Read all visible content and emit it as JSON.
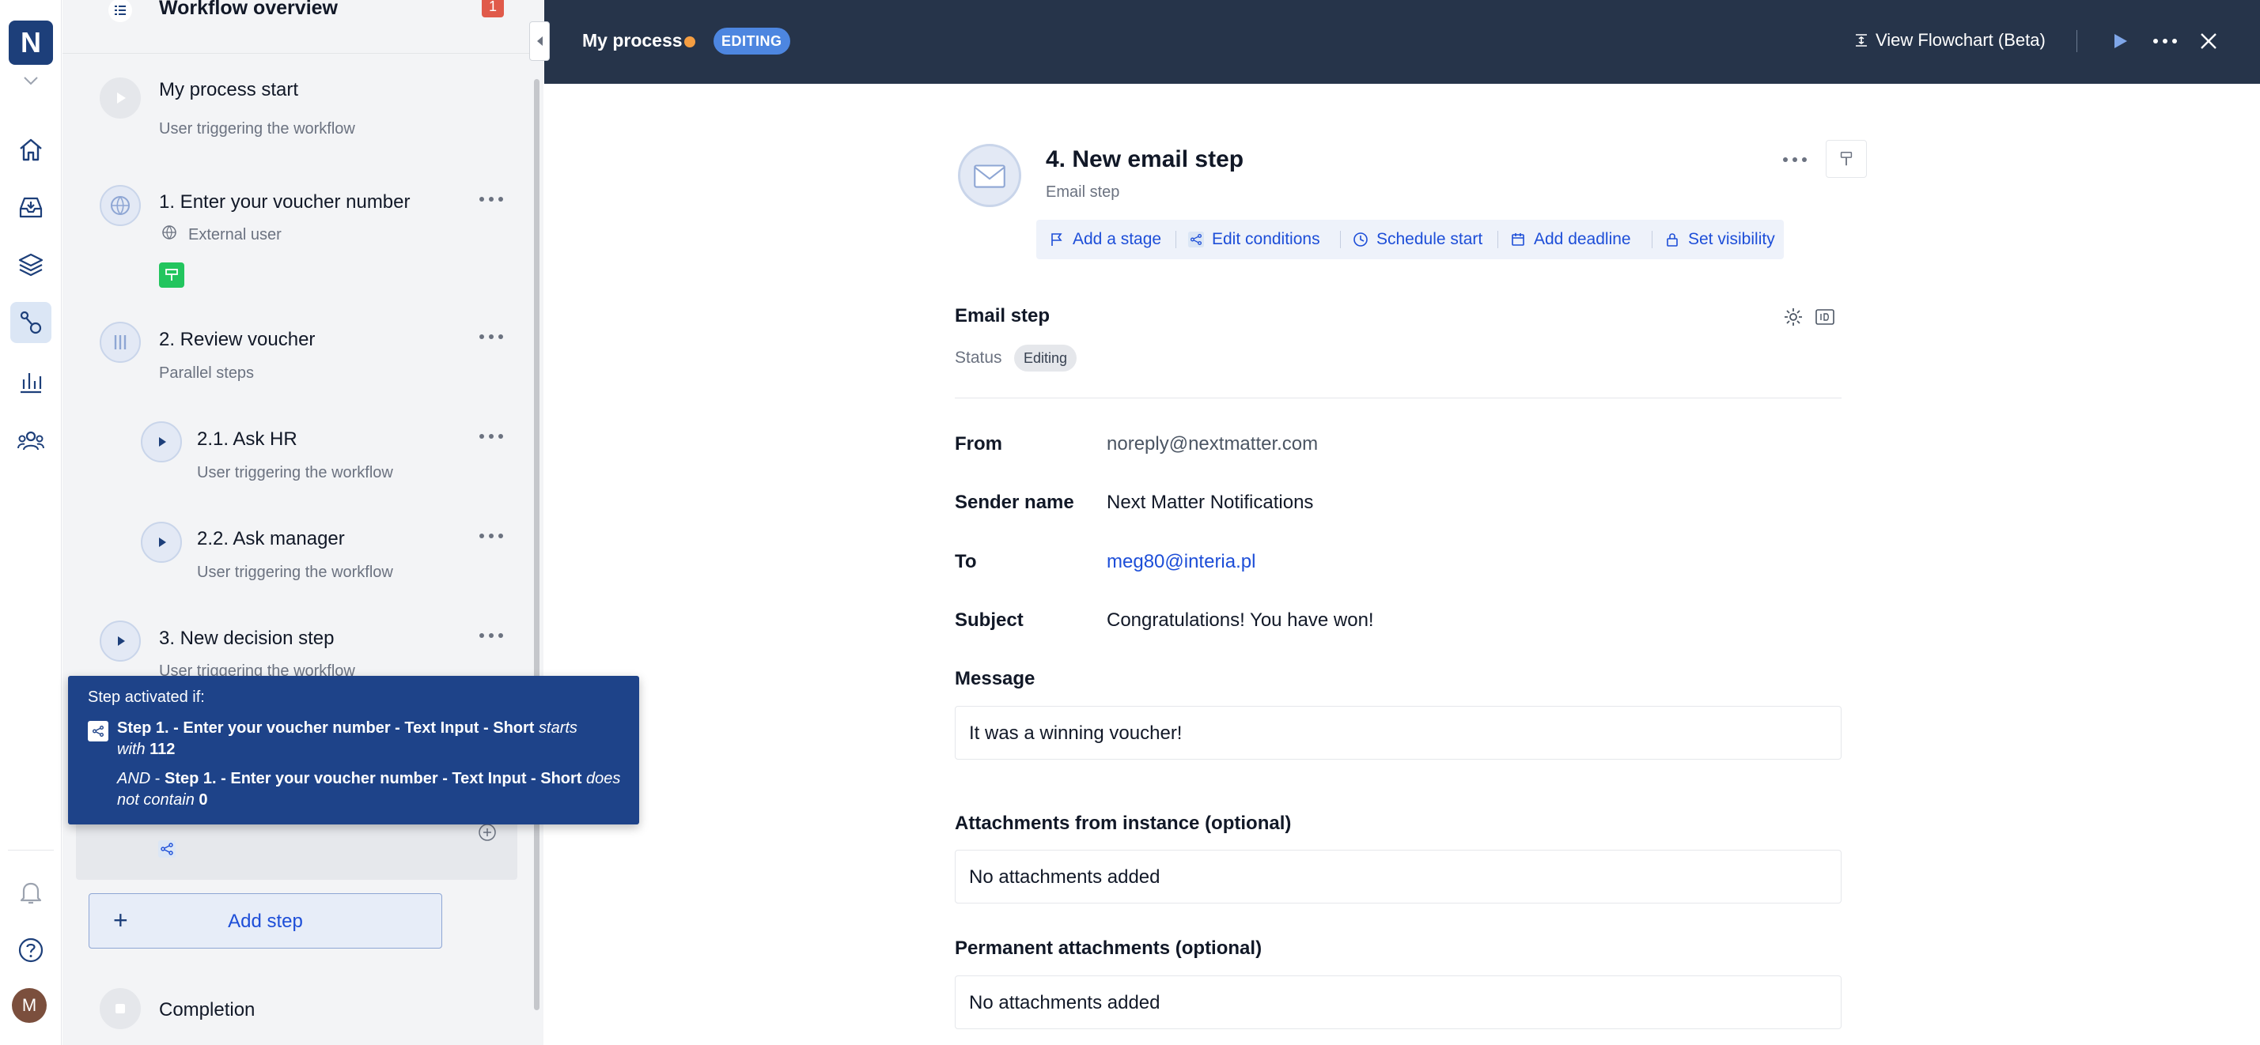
{
  "app": {
    "logo_letter": "N",
    "avatar_letter": "M"
  },
  "sidebar_nav": {
    "items": [
      {
        "icon": "home-icon"
      },
      {
        "icon": "inbox-icon"
      },
      {
        "icon": "layers-icon"
      },
      {
        "icon": "workflow-icon",
        "active": true
      },
      {
        "icon": "chart-icon"
      },
      {
        "icon": "team-icon"
      }
    ],
    "bottom": [
      {
        "icon": "bell-icon"
      },
      {
        "icon": "help-icon"
      }
    ]
  },
  "workflow": {
    "header_title": "Workflow overview",
    "header_badge": "1",
    "steps": [
      {
        "name": "My process start",
        "sub": "User triggering the workflow"
      },
      {
        "name": "1. Enter your voucher number",
        "sub": "External user"
      },
      {
        "name": "2. Review voucher",
        "sub": "Parallel steps"
      },
      {
        "name": "2.1. Ask HR",
        "sub": "User triggering the workflow"
      },
      {
        "name": "2.2. Ask manager",
        "sub": "User triggering the workflow"
      },
      {
        "name": "3. New decision step",
        "sub": "User triggering the workflow"
      }
    ],
    "add_step_label": "Add step",
    "completion_label": "Completion"
  },
  "tooltip": {
    "title": "Step activated if:",
    "cond1_subject": "Step 1. - Enter your voucher number - Text Input - Short",
    "cond1_op": "starts with",
    "cond1_value": "112",
    "cond2_join": "AND",
    "cond2_subject": "Step 1. - Enter your voucher number - Text Input - Short",
    "cond2_op": "does not contain",
    "cond2_value": "0"
  },
  "topbar": {
    "process_name": "My process",
    "status": "EDITING",
    "view_flowchart": "View Flowchart (Beta)"
  },
  "step": {
    "title": "4. New email step",
    "type": "Email step",
    "actions": [
      "Add a stage",
      "Edit conditions",
      "Schedule start",
      "Add deadline",
      "Set visibility"
    ],
    "section_title": "Email step",
    "status_label": "Status",
    "status_value": "Editing",
    "fields": {
      "from_label": "From",
      "from_value": "noreply@nextmatter.com",
      "sender_label": "Sender name",
      "sender_value": "Next Matter Notifications",
      "to_label": "To",
      "to_value": "meg80@interia.pl",
      "subject_label": "Subject",
      "subject_value": "Congratulations! You have won!",
      "message_label": "Message",
      "message_value": "It was a winning voucher!",
      "attach_instance_label": "Attachments from instance (optional)",
      "attach_instance_value": "No attachments added",
      "attach_perm_label": "Permanent attachments (optional)",
      "attach_perm_value": "No attachments added"
    }
  },
  "colors": {
    "brand_navy": "#1d3f7a",
    "topbar": "#26344a",
    "link_blue": "#1d4ed8",
    "tooltip_bg": "#1e4389",
    "badge_red": "#e05a4a",
    "dot_orange": "#f59e42",
    "editing_blue": "#4d86e0",
    "green_icon": "#22c55e"
  }
}
